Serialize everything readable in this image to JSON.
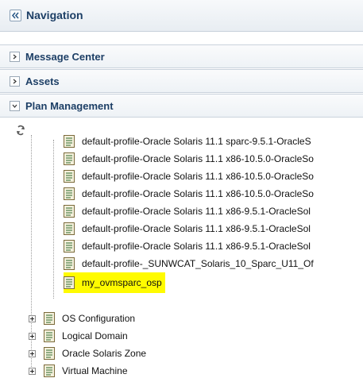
{
  "header": {
    "title": "Navigation",
    "collapse_icon": "double-chevron-left-icon"
  },
  "accordions": [
    {
      "label": "Message Center",
      "state": "collapsed"
    },
    {
      "label": "Assets",
      "state": "collapsed"
    },
    {
      "label": "Plan Management",
      "state": "expanded"
    }
  ],
  "tree": {
    "refresh_icon": "refresh-icon",
    "profiles": [
      "default-profile-Oracle Solaris 11.1 sparc-9.5.1-OracleS",
      "default-profile-Oracle Solaris 11.1 x86-10.5.0-OracleSo",
      "default-profile-Oracle Solaris 11.1 x86-10.5.0-OracleSo",
      "default-profile-Oracle Solaris 11.1 x86-10.5.0-OracleSo",
      "default-profile-Oracle Solaris 11.1 x86-9.5.1-OracleSol",
      "default-profile-Oracle Solaris 11.1 x86-9.5.1-OracleSol",
      "default-profile-Oracle Solaris 11.1 x86-9.5.1-OracleSol",
      "default-profile-_SUNWCAT_Solaris_10_Sparc_U11_Of",
      "my_ovmsparc_osp"
    ],
    "selected_profile": "my_ovmsparc_osp",
    "categories": [
      "OS Configuration",
      "Logical Domain",
      "Oracle Solaris Zone",
      "Virtual Machine"
    ]
  },
  "colors": {
    "highlight": "#fffb00",
    "header_text": "#1d3f66"
  }
}
